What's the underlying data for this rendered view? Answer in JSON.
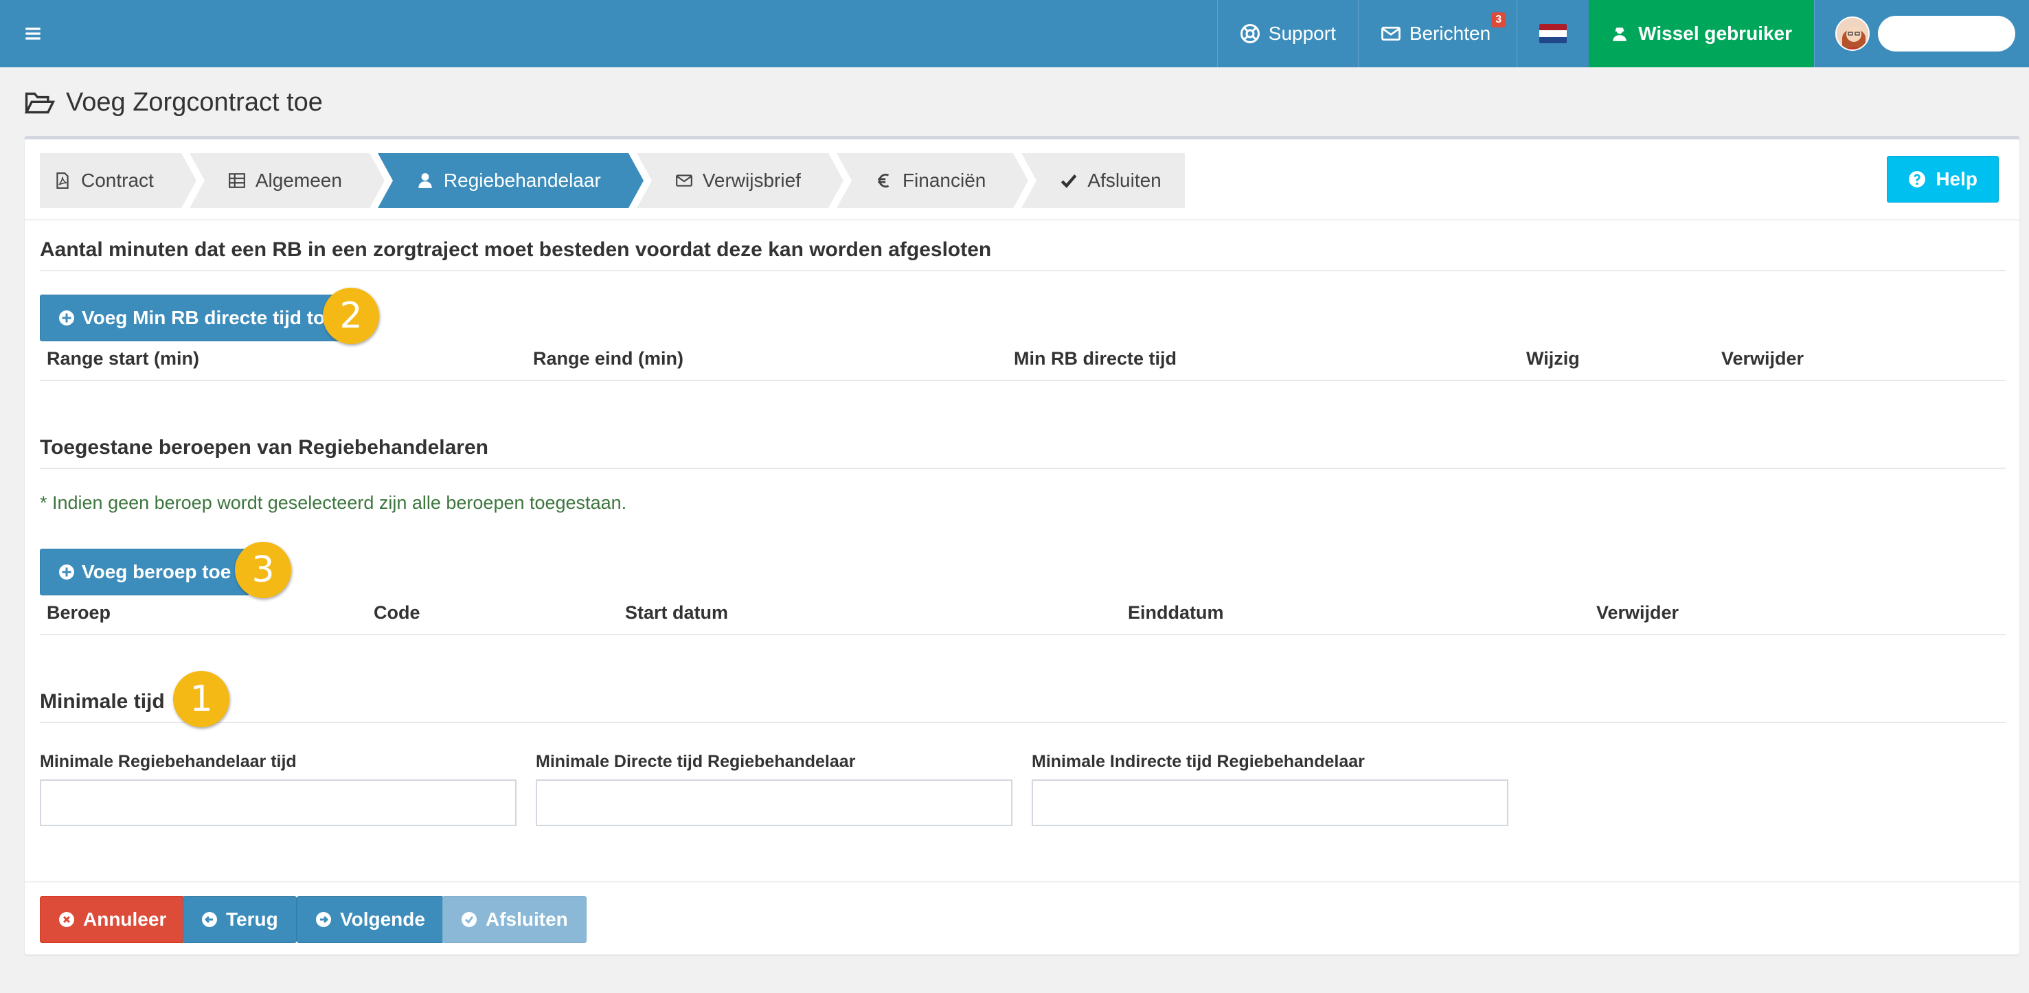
{
  "topbar": {
    "support_label": "Support",
    "messages_label": "Berichten",
    "messages_count": "3",
    "switch_user_label": "Wissel gebruiker",
    "brand_color": "#3c8dbc"
  },
  "page": {
    "title": "Voeg Zorgcontract toe"
  },
  "wizard": {
    "steps": [
      {
        "label": "Contract",
        "icon": "pdf-file-icon"
      },
      {
        "label": "Algemeen",
        "icon": "table-icon"
      },
      {
        "label": "Regiebehandelaar",
        "icon": "user-icon",
        "active": true
      },
      {
        "label": "Verwijsbrief",
        "icon": "envelope-icon"
      },
      {
        "label": "Financiën",
        "icon": "euro-icon"
      },
      {
        "label": "Afsluiten",
        "icon": "check-icon"
      }
    ],
    "help_label": "Help"
  },
  "section_minutes": {
    "title": "Aantal minuten dat een RB in een zorgtraject moet besteden voordat deze kan worden afgesloten",
    "add_button": "Voeg Min RB directe tijd toe",
    "callout": "2",
    "columns": [
      "Range start (min)",
      "Range eind (min)",
      "Min RB directe tijd",
      "Wijzig",
      "Verwijder"
    ]
  },
  "section_professions": {
    "title": "Toegestane beroepen van Regiebehandelaren",
    "hint": "* Indien geen beroep wordt geselecteerd zijn alle beroepen toegestaan.",
    "add_button": "Voeg beroep toe",
    "callout": "3",
    "columns": [
      "Beroep",
      "Code",
      "Start datum",
      "Einddatum",
      "Verwijder"
    ]
  },
  "section_min_time": {
    "title": "Minimale tijd",
    "callout": "1",
    "fields": [
      {
        "label": "Minimale Regiebehandelaar tijd",
        "value": ""
      },
      {
        "label": "Minimale Directe tijd Regiebehandelaar",
        "value": ""
      },
      {
        "label": "Minimale Indirecte tijd Regiebehandelaar",
        "value": ""
      }
    ]
  },
  "footer": {
    "cancel_label": "Annuleer",
    "back_label": "Terug",
    "next_label": "Volgende",
    "finish_label": "Afsluiten"
  }
}
